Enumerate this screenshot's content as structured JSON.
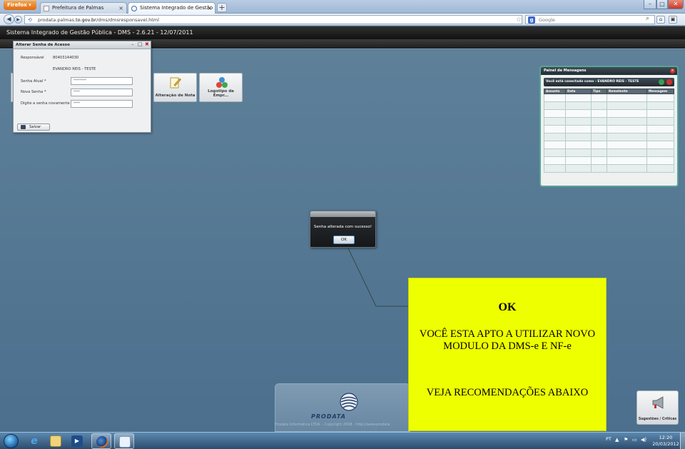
{
  "browser": {
    "menu_button_label": "Firefox",
    "tabs": [
      {
        "label": "Prefeitura de Palmas"
      },
      {
        "label": "Sistema Integrado de Gestão Pública ..."
      }
    ],
    "new_tab_label": "+",
    "url_prefix": "prodata.palmas.",
    "url_domain": "to.gov.br",
    "url_suffix": "/dms/dmsresponsavel.html",
    "search_engine": "Google",
    "search_placeholder": "Google"
  },
  "app": {
    "title": "Sistema Integrado de Gestão Pública - DMS - 2.6.21 - 12/07/2011"
  },
  "tiles": [
    {
      "label": "Alteração de Nota",
      "icon": "edit-note-icon"
    },
    {
      "label": "Logotipo da Empr...",
      "icon": "logo-balls-icon"
    }
  ],
  "pwd_dialog": {
    "title": "Alterar Senha de Acesso",
    "responsavel_label": "Responsável",
    "responsavel_id": "80403144030",
    "responsavel_name": "EVANDRO REIS - TESTE",
    "fields": [
      {
        "label": "Senha Atual *",
        "value": "********"
      },
      {
        "label": "Nova Senha *",
        "value": "****"
      },
      {
        "label": "Digite a senha novamente *",
        "value": "****"
      }
    ],
    "save_label": "Salvar"
  },
  "messages_panel": {
    "title": "Painel de Mensagens",
    "connected_text": "Você está conectado como - EVANDRO REIS - TESTE",
    "columns": [
      "Assunto",
      "Data",
      "Tipo",
      "Remetente",
      "Mensagem"
    ]
  },
  "alert": {
    "message": "Senha alterada com sucesso!",
    "ok_label": "OK"
  },
  "footer": {
    "brand": "PRODATA",
    "copyright": "Prodata Informática LTDA. - Copyright 2008 - http://www.prodata"
  },
  "suggestions": {
    "label": "Sugestões / Críticas"
  },
  "note": {
    "heading": "OK",
    "body": "VOCÊ ESTA APTO A UTILIZAR NOVO MODULO DA DMS-e E NF-e",
    "footer": "VEJA RECOMENDAÇÕES ABAIXO"
  },
  "taskbar": {
    "language": "PT",
    "time": "12:20",
    "date": "20/03/2012"
  },
  "colors": {
    "desktop_bg": "#4d7290",
    "note_yellow": "#eeff00",
    "panel_border": "#55a595",
    "header_dark": "#1a1a1a"
  }
}
